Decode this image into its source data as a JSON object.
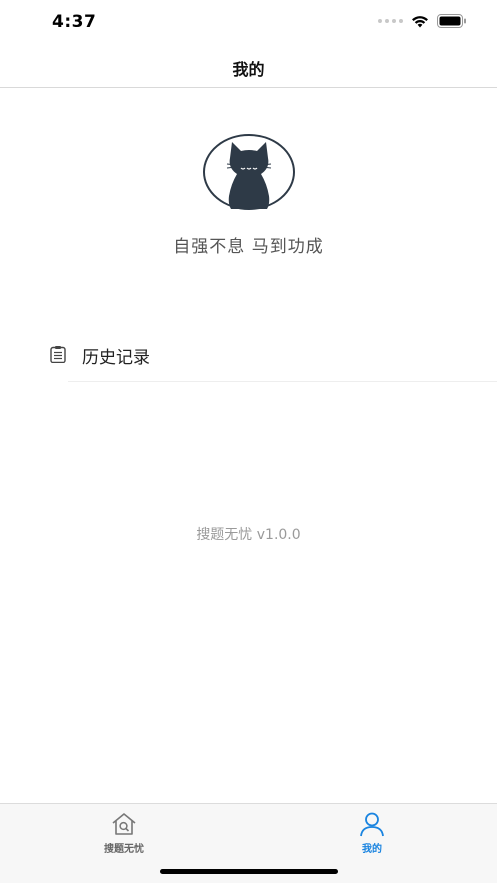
{
  "status_bar": {
    "time": "4:37"
  },
  "nav": {
    "title": "我的"
  },
  "profile": {
    "motto": "自强不息 马到功成",
    "avatar_icon": "black-cat-icon"
  },
  "menu": [
    {
      "label": "历史记录",
      "icon": "clipboard-list-icon"
    }
  ],
  "footer": {
    "version": "搜题无忧  v1.0.0"
  },
  "tabs": [
    {
      "label": "搜题无忧",
      "icon": "house-search-icon",
      "active": false
    },
    {
      "label": "我的",
      "icon": "person-icon",
      "active": true
    }
  ],
  "colors": {
    "accent": "#1a84e0",
    "avatar_dark": "#2e3a47",
    "divider": "#d9d9d9"
  }
}
